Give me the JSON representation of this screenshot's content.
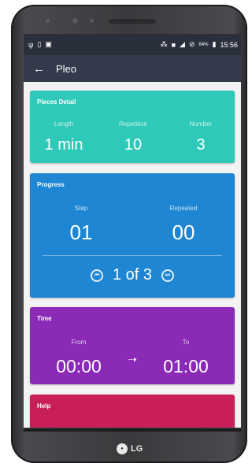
{
  "status_bar": {
    "left_icons": [
      "usb-icon",
      "sim-icon",
      "image-icon"
    ],
    "right_icons": [
      "vibrate-icon",
      "notification-icon",
      "signal-icon",
      "no-disturb-icon",
      "battery-icon"
    ],
    "battery": "84%",
    "time": "15:56"
  },
  "toolbar": {
    "back_icon": "arrow-left-icon",
    "title": "Pleo"
  },
  "pieces_detail": {
    "title": "Pieces Detail",
    "columns": [
      {
        "label": "Length",
        "value": "1 min"
      },
      {
        "label": "Repetition",
        "value": "10"
      },
      {
        "label": "Number",
        "value": "3"
      }
    ],
    "color": "#2ec9b8"
  },
  "progress": {
    "title": "Progress",
    "step_label": "Step",
    "step_value": "01",
    "repeated_label": "Repeated",
    "repeated_value": "00",
    "pager_text": "1 of 3",
    "prev_icon": "skip-previous-icon",
    "next_icon": "skip-next-icon",
    "color": "#1e86d2"
  },
  "time": {
    "title": "Time",
    "from_label": "From",
    "from_value": "00:00",
    "arrow_icon": "arrow-right-icon",
    "to_label": "To",
    "to_value": "01:00",
    "color": "#8a2ab6"
  },
  "help": {
    "title": "Help",
    "color": "#c81f5a"
  },
  "device": {
    "brand": "LG"
  }
}
